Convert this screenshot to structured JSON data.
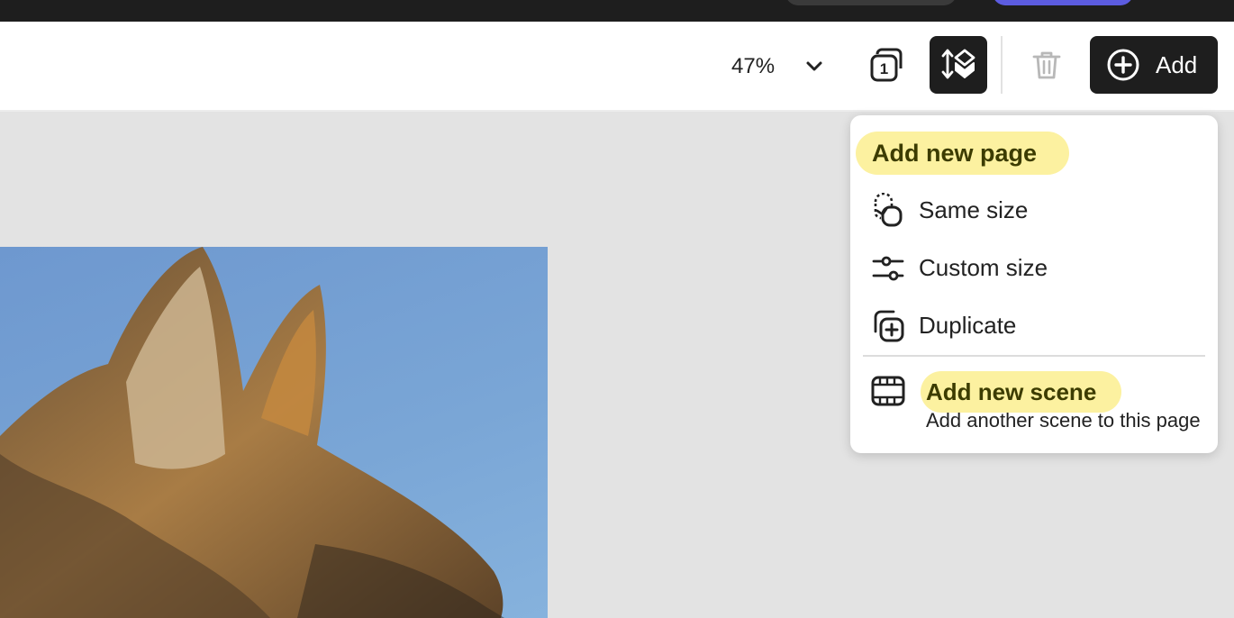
{
  "toolbar": {
    "zoom": "47%",
    "add_label": "Add"
  },
  "menu": {
    "heading": "Add new page",
    "items": [
      {
        "label": "Same size",
        "icon": "same-size-icon"
      },
      {
        "label": "Custom size",
        "icon": "sliders-icon"
      },
      {
        "label": "Duplicate",
        "icon": "duplicate-icon"
      }
    ],
    "scene": {
      "title": "Add new scene",
      "description": "Add another scene to this page",
      "icon": "film-icon"
    }
  },
  "colors": {
    "dark": "#1e1e1e",
    "highlight": "#fcf1a0",
    "canvas": "#e3e3e3",
    "sky": "#7aa6d6"
  }
}
